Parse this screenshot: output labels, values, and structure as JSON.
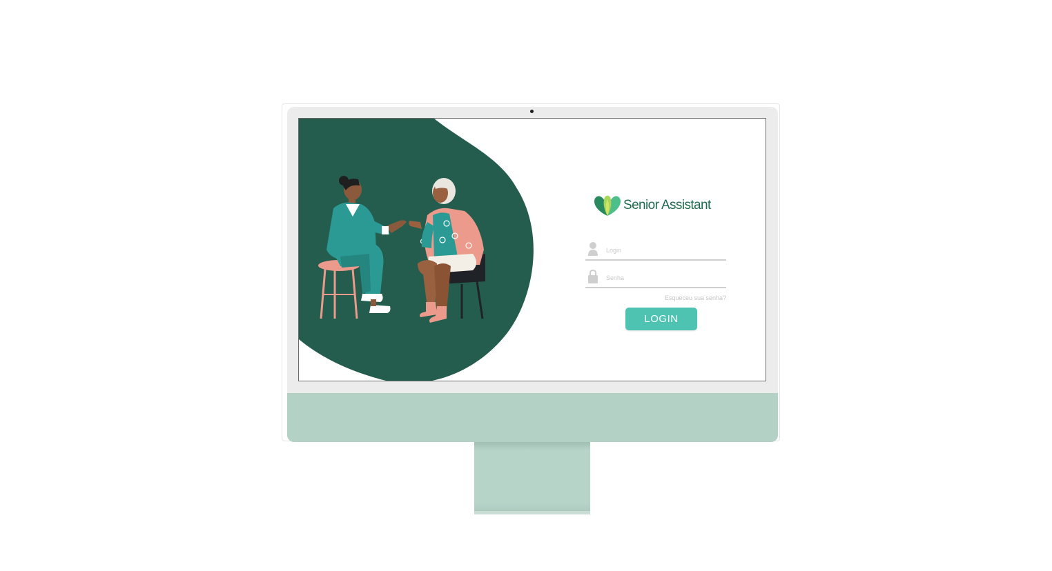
{
  "brand": {
    "name": "Senior Assistant",
    "color": "#1f6b4f"
  },
  "login_form": {
    "login_placeholder": "Login",
    "password_placeholder": "Senha",
    "forgot_link": "Esqueceu sua senha?",
    "submit_label": "LOGIN",
    "button_color": "#4ec3b2"
  },
  "illustration": {
    "background_color": "#245d4d",
    "subject": "caregiver-with-elderly-woman"
  },
  "monitor": {
    "chin_color": "#b4d1c6"
  }
}
